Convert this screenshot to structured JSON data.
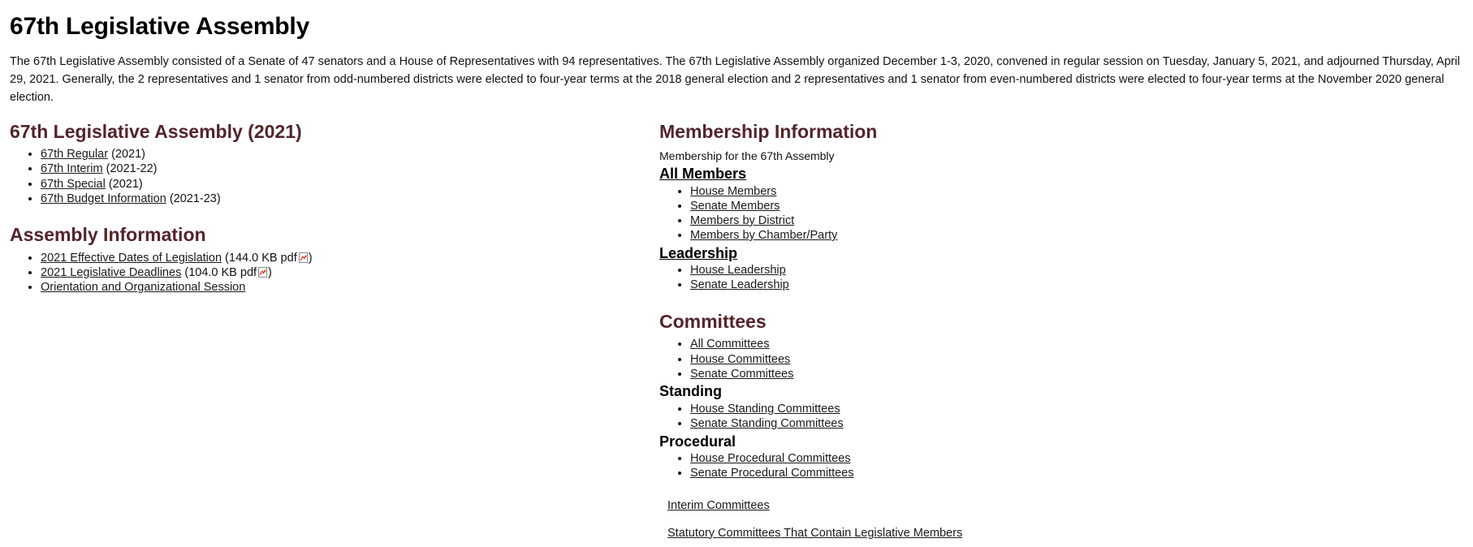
{
  "page": {
    "title": "67th Legislative Assembly",
    "intro": "The 67th Legislative Assembly consisted of a Senate of 47 senators and a House of Representatives with 94 representatives. The 67th Legislative Assembly organized December 1-3, 2020, convened in regular session on Tuesday, January 5, 2021, and adjourned Thursday, April 29, 2021. Generally, the 2 representatives and 1 senator from odd-numbered districts were elected to four-year terms at the 2018 general election and 2 representatives and 1 senator from even-numbered districts were elected to four-year terms at the November 2020 general election."
  },
  "left": {
    "assembly_section": {
      "heading": "67th Legislative Assembly (2021)",
      "items": [
        {
          "label": "67th Regular",
          "meta": "(2021)"
        },
        {
          "label": "67th Interim",
          "meta": "(2021-22)"
        },
        {
          "label": "67th Special",
          "meta": "(2021)"
        },
        {
          "label": "67th Budget Information",
          "meta": "(2021-23)"
        }
      ]
    },
    "assembly_info_section": {
      "heading": "Assembly Information",
      "items": [
        {
          "label": "2021 Effective Dates of Legislation",
          "meta_open": "(144.0 KB pdf",
          "icon": "pdf-icon",
          "meta_close": ")"
        },
        {
          "label": "2021 Legislative Deadlines",
          "meta_open": "(104.0 KB pdf",
          "icon": "pdf-icon",
          "meta_close": ")"
        },
        {
          "label": "Orientation and Organizational Session",
          "meta_open": "",
          "icon": "",
          "meta_close": ""
        }
      ]
    }
  },
  "right": {
    "membership_section": {
      "heading": "Membership Information",
      "note": "Membership for the 67th Assembly",
      "all_members_heading": "All Members",
      "all_members_items": [
        "House Members",
        "Senate Members",
        "Members by District",
        "Members by Chamber/Party"
      ],
      "leadership_heading": "Leadership",
      "leadership_items": [
        "House Leadership",
        "Senate Leadership"
      ]
    },
    "committees_section": {
      "heading": "Committees",
      "top_items": [
        "All Committees",
        "House Committees",
        "Senate Committees"
      ],
      "standing_heading": "Standing",
      "standing_items": [
        "House Standing Committees",
        "Senate Standing Committees"
      ],
      "procedural_heading": "Procedural",
      "procedural_items": [
        "House Procedural Committees",
        "Senate Procedural Committees"
      ],
      "interim_link": "Interim Committees",
      "statutory_link": "Statutory Committees That Contain Legislative Members"
    }
  },
  "colors": {
    "heading_maroon": "#54242a",
    "text_black": "#111111",
    "pdf_icon_red": "#e02b20"
  }
}
